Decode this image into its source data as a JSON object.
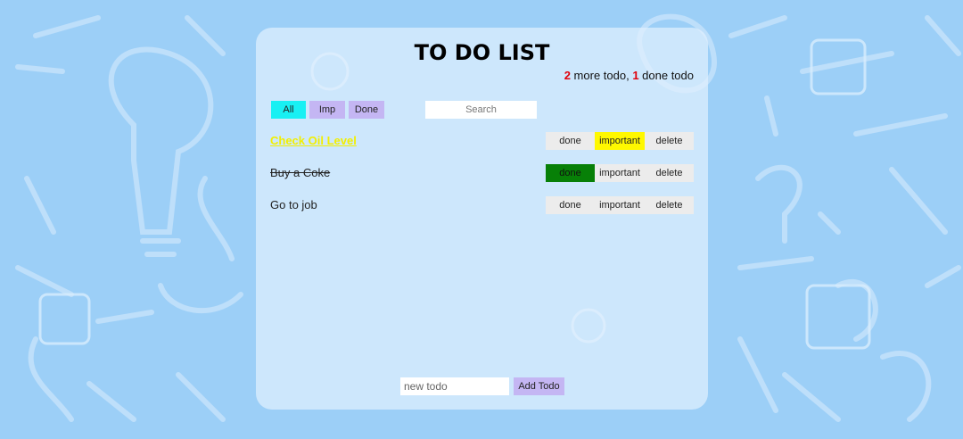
{
  "app": {
    "title": "TO DO LIST"
  },
  "counter": {
    "more_count": "2",
    "more_text": " more todo, ",
    "done_count": "1",
    "done_text": " done todo"
  },
  "filters": {
    "all_label": "All",
    "imp_label": "Imp",
    "done_label": "Done"
  },
  "search": {
    "placeholder": "Search"
  },
  "todos": [
    {
      "text": "Check Oil Level",
      "state": "important"
    },
    {
      "text": "Buy a Coke",
      "state": "done"
    },
    {
      "text": "Go to job",
      "state": "normal"
    }
  ],
  "actions": {
    "done_label": "done",
    "important_label": "important",
    "delete_label": "delete"
  },
  "add": {
    "placeholder": "new todo",
    "button_label": "Add Todo"
  },
  "colors": {
    "background": "#9ccff7",
    "all_filter": "#18f0f3",
    "filter_button": "#c4b6f3",
    "important_highlight": "#fff800",
    "done_highlight": "#078007",
    "counter_number": "#e0000a"
  }
}
